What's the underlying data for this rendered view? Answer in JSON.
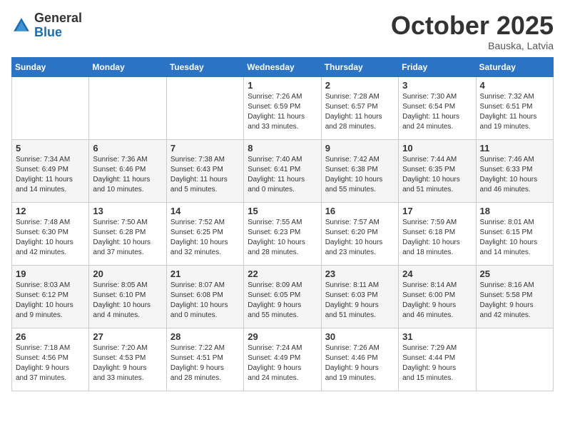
{
  "logo": {
    "general": "General",
    "blue": "Blue"
  },
  "header": {
    "month": "October 2025",
    "location": "Bauska, Latvia"
  },
  "days_of_week": [
    "Sunday",
    "Monday",
    "Tuesday",
    "Wednesday",
    "Thursday",
    "Friday",
    "Saturday"
  ],
  "weeks": [
    [
      {
        "day": "",
        "info": ""
      },
      {
        "day": "",
        "info": ""
      },
      {
        "day": "",
        "info": ""
      },
      {
        "day": "1",
        "info": "Sunrise: 7:26 AM\nSunset: 6:59 PM\nDaylight: 11 hours\nand 33 minutes."
      },
      {
        "day": "2",
        "info": "Sunrise: 7:28 AM\nSunset: 6:57 PM\nDaylight: 11 hours\nand 28 minutes."
      },
      {
        "day": "3",
        "info": "Sunrise: 7:30 AM\nSunset: 6:54 PM\nDaylight: 11 hours\nand 24 minutes."
      },
      {
        "day": "4",
        "info": "Sunrise: 7:32 AM\nSunset: 6:51 PM\nDaylight: 11 hours\nand 19 minutes."
      }
    ],
    [
      {
        "day": "5",
        "info": "Sunrise: 7:34 AM\nSunset: 6:49 PM\nDaylight: 11 hours\nand 14 minutes."
      },
      {
        "day": "6",
        "info": "Sunrise: 7:36 AM\nSunset: 6:46 PM\nDaylight: 11 hours\nand 10 minutes."
      },
      {
        "day": "7",
        "info": "Sunrise: 7:38 AM\nSunset: 6:43 PM\nDaylight: 11 hours\nand 5 minutes."
      },
      {
        "day": "8",
        "info": "Sunrise: 7:40 AM\nSunset: 6:41 PM\nDaylight: 11 hours\nand 0 minutes."
      },
      {
        "day": "9",
        "info": "Sunrise: 7:42 AM\nSunset: 6:38 PM\nDaylight: 10 hours\nand 55 minutes."
      },
      {
        "day": "10",
        "info": "Sunrise: 7:44 AM\nSunset: 6:35 PM\nDaylight: 10 hours\nand 51 minutes."
      },
      {
        "day": "11",
        "info": "Sunrise: 7:46 AM\nSunset: 6:33 PM\nDaylight: 10 hours\nand 46 minutes."
      }
    ],
    [
      {
        "day": "12",
        "info": "Sunrise: 7:48 AM\nSunset: 6:30 PM\nDaylight: 10 hours\nand 42 minutes."
      },
      {
        "day": "13",
        "info": "Sunrise: 7:50 AM\nSunset: 6:28 PM\nDaylight: 10 hours\nand 37 minutes."
      },
      {
        "day": "14",
        "info": "Sunrise: 7:52 AM\nSunset: 6:25 PM\nDaylight: 10 hours\nand 32 minutes."
      },
      {
        "day": "15",
        "info": "Sunrise: 7:55 AM\nSunset: 6:23 PM\nDaylight: 10 hours\nand 28 minutes."
      },
      {
        "day": "16",
        "info": "Sunrise: 7:57 AM\nSunset: 6:20 PM\nDaylight: 10 hours\nand 23 minutes."
      },
      {
        "day": "17",
        "info": "Sunrise: 7:59 AM\nSunset: 6:18 PM\nDaylight: 10 hours\nand 18 minutes."
      },
      {
        "day": "18",
        "info": "Sunrise: 8:01 AM\nSunset: 6:15 PM\nDaylight: 10 hours\nand 14 minutes."
      }
    ],
    [
      {
        "day": "19",
        "info": "Sunrise: 8:03 AM\nSunset: 6:12 PM\nDaylight: 10 hours\nand 9 minutes."
      },
      {
        "day": "20",
        "info": "Sunrise: 8:05 AM\nSunset: 6:10 PM\nDaylight: 10 hours\nand 4 minutes."
      },
      {
        "day": "21",
        "info": "Sunrise: 8:07 AM\nSunset: 6:08 PM\nDaylight: 10 hours\nand 0 minutes."
      },
      {
        "day": "22",
        "info": "Sunrise: 8:09 AM\nSunset: 6:05 PM\nDaylight: 9 hours\nand 55 minutes."
      },
      {
        "day": "23",
        "info": "Sunrise: 8:11 AM\nSunset: 6:03 PM\nDaylight: 9 hours\nand 51 minutes."
      },
      {
        "day": "24",
        "info": "Sunrise: 8:14 AM\nSunset: 6:00 PM\nDaylight: 9 hours\nand 46 minutes."
      },
      {
        "day": "25",
        "info": "Sunrise: 8:16 AM\nSunset: 5:58 PM\nDaylight: 9 hours\nand 42 minutes."
      }
    ],
    [
      {
        "day": "26",
        "info": "Sunrise: 7:18 AM\nSunset: 4:56 PM\nDaylight: 9 hours\nand 37 minutes."
      },
      {
        "day": "27",
        "info": "Sunrise: 7:20 AM\nSunset: 4:53 PM\nDaylight: 9 hours\nand 33 minutes."
      },
      {
        "day": "28",
        "info": "Sunrise: 7:22 AM\nSunset: 4:51 PM\nDaylight: 9 hours\nand 28 minutes."
      },
      {
        "day": "29",
        "info": "Sunrise: 7:24 AM\nSunset: 4:49 PM\nDaylight: 9 hours\nand 24 minutes."
      },
      {
        "day": "30",
        "info": "Sunrise: 7:26 AM\nSunset: 4:46 PM\nDaylight: 9 hours\nand 19 minutes."
      },
      {
        "day": "31",
        "info": "Sunrise: 7:29 AM\nSunset: 4:44 PM\nDaylight: 9 hours\nand 15 minutes."
      },
      {
        "day": "",
        "info": ""
      }
    ]
  ]
}
